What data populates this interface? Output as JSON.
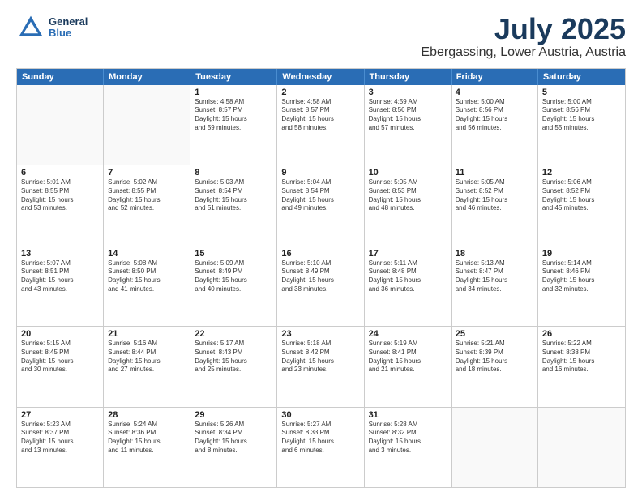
{
  "header": {
    "logo_line1": "General",
    "logo_line2": "Blue",
    "title": "July 2025",
    "subtitle": "Ebergassing, Lower Austria, Austria"
  },
  "calendar": {
    "days_of_week": [
      "Sunday",
      "Monday",
      "Tuesday",
      "Wednesday",
      "Thursday",
      "Friday",
      "Saturday"
    ],
    "rows": [
      [
        {
          "day": "",
          "lines": []
        },
        {
          "day": "",
          "lines": []
        },
        {
          "day": "1",
          "lines": [
            "Sunrise: 4:58 AM",
            "Sunset: 8:57 PM",
            "Daylight: 15 hours",
            "and 59 minutes."
          ]
        },
        {
          "day": "2",
          "lines": [
            "Sunrise: 4:58 AM",
            "Sunset: 8:57 PM",
            "Daylight: 15 hours",
            "and 58 minutes."
          ]
        },
        {
          "day": "3",
          "lines": [
            "Sunrise: 4:59 AM",
            "Sunset: 8:56 PM",
            "Daylight: 15 hours",
            "and 57 minutes."
          ]
        },
        {
          "day": "4",
          "lines": [
            "Sunrise: 5:00 AM",
            "Sunset: 8:56 PM",
            "Daylight: 15 hours",
            "and 56 minutes."
          ]
        },
        {
          "day": "5",
          "lines": [
            "Sunrise: 5:00 AM",
            "Sunset: 8:56 PM",
            "Daylight: 15 hours",
            "and 55 minutes."
          ]
        }
      ],
      [
        {
          "day": "6",
          "lines": [
            "Sunrise: 5:01 AM",
            "Sunset: 8:55 PM",
            "Daylight: 15 hours",
            "and 53 minutes."
          ]
        },
        {
          "day": "7",
          "lines": [
            "Sunrise: 5:02 AM",
            "Sunset: 8:55 PM",
            "Daylight: 15 hours",
            "and 52 minutes."
          ]
        },
        {
          "day": "8",
          "lines": [
            "Sunrise: 5:03 AM",
            "Sunset: 8:54 PM",
            "Daylight: 15 hours",
            "and 51 minutes."
          ]
        },
        {
          "day": "9",
          "lines": [
            "Sunrise: 5:04 AM",
            "Sunset: 8:54 PM",
            "Daylight: 15 hours",
            "and 49 minutes."
          ]
        },
        {
          "day": "10",
          "lines": [
            "Sunrise: 5:05 AM",
            "Sunset: 8:53 PM",
            "Daylight: 15 hours",
            "and 48 minutes."
          ]
        },
        {
          "day": "11",
          "lines": [
            "Sunrise: 5:05 AM",
            "Sunset: 8:52 PM",
            "Daylight: 15 hours",
            "and 46 minutes."
          ]
        },
        {
          "day": "12",
          "lines": [
            "Sunrise: 5:06 AM",
            "Sunset: 8:52 PM",
            "Daylight: 15 hours",
            "and 45 minutes."
          ]
        }
      ],
      [
        {
          "day": "13",
          "lines": [
            "Sunrise: 5:07 AM",
            "Sunset: 8:51 PM",
            "Daylight: 15 hours",
            "and 43 minutes."
          ]
        },
        {
          "day": "14",
          "lines": [
            "Sunrise: 5:08 AM",
            "Sunset: 8:50 PM",
            "Daylight: 15 hours",
            "and 41 minutes."
          ]
        },
        {
          "day": "15",
          "lines": [
            "Sunrise: 5:09 AM",
            "Sunset: 8:49 PM",
            "Daylight: 15 hours",
            "and 40 minutes."
          ]
        },
        {
          "day": "16",
          "lines": [
            "Sunrise: 5:10 AM",
            "Sunset: 8:49 PM",
            "Daylight: 15 hours",
            "and 38 minutes."
          ]
        },
        {
          "day": "17",
          "lines": [
            "Sunrise: 5:11 AM",
            "Sunset: 8:48 PM",
            "Daylight: 15 hours",
            "and 36 minutes."
          ]
        },
        {
          "day": "18",
          "lines": [
            "Sunrise: 5:13 AM",
            "Sunset: 8:47 PM",
            "Daylight: 15 hours",
            "and 34 minutes."
          ]
        },
        {
          "day": "19",
          "lines": [
            "Sunrise: 5:14 AM",
            "Sunset: 8:46 PM",
            "Daylight: 15 hours",
            "and 32 minutes."
          ]
        }
      ],
      [
        {
          "day": "20",
          "lines": [
            "Sunrise: 5:15 AM",
            "Sunset: 8:45 PM",
            "Daylight: 15 hours",
            "and 30 minutes."
          ]
        },
        {
          "day": "21",
          "lines": [
            "Sunrise: 5:16 AM",
            "Sunset: 8:44 PM",
            "Daylight: 15 hours",
            "and 27 minutes."
          ]
        },
        {
          "day": "22",
          "lines": [
            "Sunrise: 5:17 AM",
            "Sunset: 8:43 PM",
            "Daylight: 15 hours",
            "and 25 minutes."
          ]
        },
        {
          "day": "23",
          "lines": [
            "Sunrise: 5:18 AM",
            "Sunset: 8:42 PM",
            "Daylight: 15 hours",
            "and 23 minutes."
          ]
        },
        {
          "day": "24",
          "lines": [
            "Sunrise: 5:19 AM",
            "Sunset: 8:41 PM",
            "Daylight: 15 hours",
            "and 21 minutes."
          ]
        },
        {
          "day": "25",
          "lines": [
            "Sunrise: 5:21 AM",
            "Sunset: 8:39 PM",
            "Daylight: 15 hours",
            "and 18 minutes."
          ]
        },
        {
          "day": "26",
          "lines": [
            "Sunrise: 5:22 AM",
            "Sunset: 8:38 PM",
            "Daylight: 15 hours",
            "and 16 minutes."
          ]
        }
      ],
      [
        {
          "day": "27",
          "lines": [
            "Sunrise: 5:23 AM",
            "Sunset: 8:37 PM",
            "Daylight: 15 hours",
            "and 13 minutes."
          ]
        },
        {
          "day": "28",
          "lines": [
            "Sunrise: 5:24 AM",
            "Sunset: 8:36 PM",
            "Daylight: 15 hours",
            "and 11 minutes."
          ]
        },
        {
          "day": "29",
          "lines": [
            "Sunrise: 5:26 AM",
            "Sunset: 8:34 PM",
            "Daylight: 15 hours",
            "and 8 minutes."
          ]
        },
        {
          "day": "30",
          "lines": [
            "Sunrise: 5:27 AM",
            "Sunset: 8:33 PM",
            "Daylight: 15 hours",
            "and 6 minutes."
          ]
        },
        {
          "day": "31",
          "lines": [
            "Sunrise: 5:28 AM",
            "Sunset: 8:32 PM",
            "Daylight: 15 hours",
            "and 3 minutes."
          ]
        },
        {
          "day": "",
          "lines": []
        },
        {
          "day": "",
          "lines": []
        }
      ]
    ]
  }
}
